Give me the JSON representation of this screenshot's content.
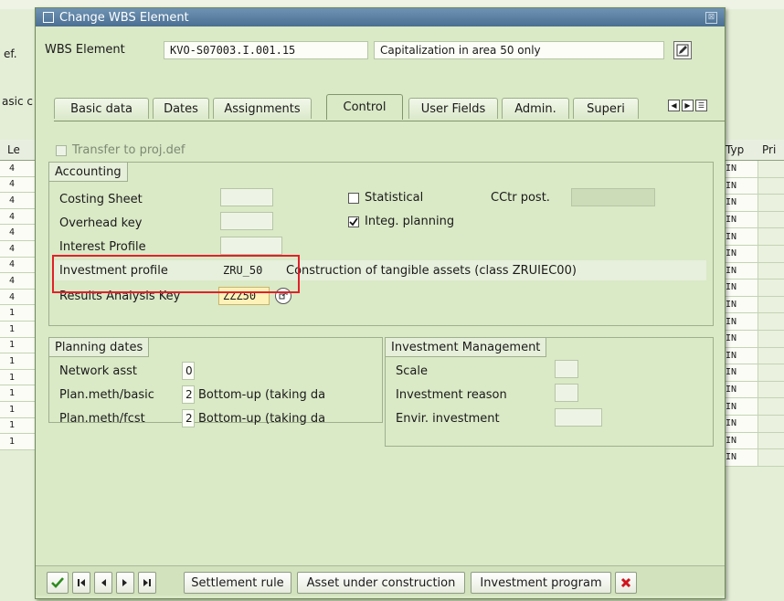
{
  "background": {
    "left_labels": [
      "ef.",
      "asic c"
    ],
    "left_grid_header": "Le",
    "left_grid_values": [
      "4",
      "4",
      "4",
      "4",
      "4",
      "4",
      "4",
      "4",
      "4",
      "1",
      "1",
      "1",
      "1",
      "1",
      "1",
      "1",
      "1",
      "1"
    ],
    "right_grid_headers": [
      "Typ",
      "Pri"
    ],
    "right_grid_values": [
      "IN",
      "IN",
      "IN",
      "IN",
      "IN",
      "IN",
      "IN",
      "IN",
      "IN",
      "IN",
      "IN",
      "IN",
      "IN",
      "IN",
      "IN",
      "IN",
      "IN",
      "IN"
    ]
  },
  "dialog": {
    "title": "Change WBS Element",
    "close_glyph": "⊠",
    "wbs_label": "WBS Element",
    "wbs_value": "KVO-S07003.I.001.15",
    "wbs_description": "Capitalization in area 50 only",
    "tabs": [
      "Basic data",
      "Dates",
      "Assignments",
      "Control",
      "User Fields",
      "Admin.",
      "Superi"
    ],
    "active_tab": "Control"
  },
  "control": {
    "transfer_label": "Transfer to proj.def",
    "accounting": {
      "title": "Accounting",
      "costing_sheet_label": "Costing Sheet",
      "overhead_key_label": "Overhead key",
      "interest_profile_label": "Interest Profile",
      "investment_profile_label": "Investment profile",
      "investment_profile_value": "ZRU_50",
      "investment_profile_desc": "Construction of tangible assets (class ZRUIEC00)",
      "ra_key_label": "Results Analysis Key",
      "ra_key_value": "ZZZ50",
      "statistical_label": "Statistical",
      "cctr_post_label": "CCtr post.",
      "integ_planning_label": "Integ. planning",
      "integ_planning_checked": true,
      "statistical_checked": false
    },
    "planning": {
      "title": "Planning dates",
      "network_asst_label": "Network asst",
      "network_asst_value": "0",
      "basic_label": "Plan.meth/basic",
      "basic_value": "2",
      "basic_desc": "Bottom-up (taking da",
      "fcst_label": "Plan.meth/fcst",
      "fcst_value": "2",
      "fcst_desc": "Bottom-up (taking da"
    },
    "investment": {
      "title": "Investment Management",
      "scale_label": "Scale",
      "reason_label": "Investment reason",
      "envir_label": "Envir. investment"
    }
  },
  "toolbar": {
    "settlement_rule": "Settlement rule",
    "asset_under_construction": "Asset under construction",
    "investment_program": "Investment program"
  },
  "colors": {
    "highlight_box": "#e0212b",
    "confirm_green": "#2e8b1f",
    "cancel_red": "#d0141c"
  }
}
